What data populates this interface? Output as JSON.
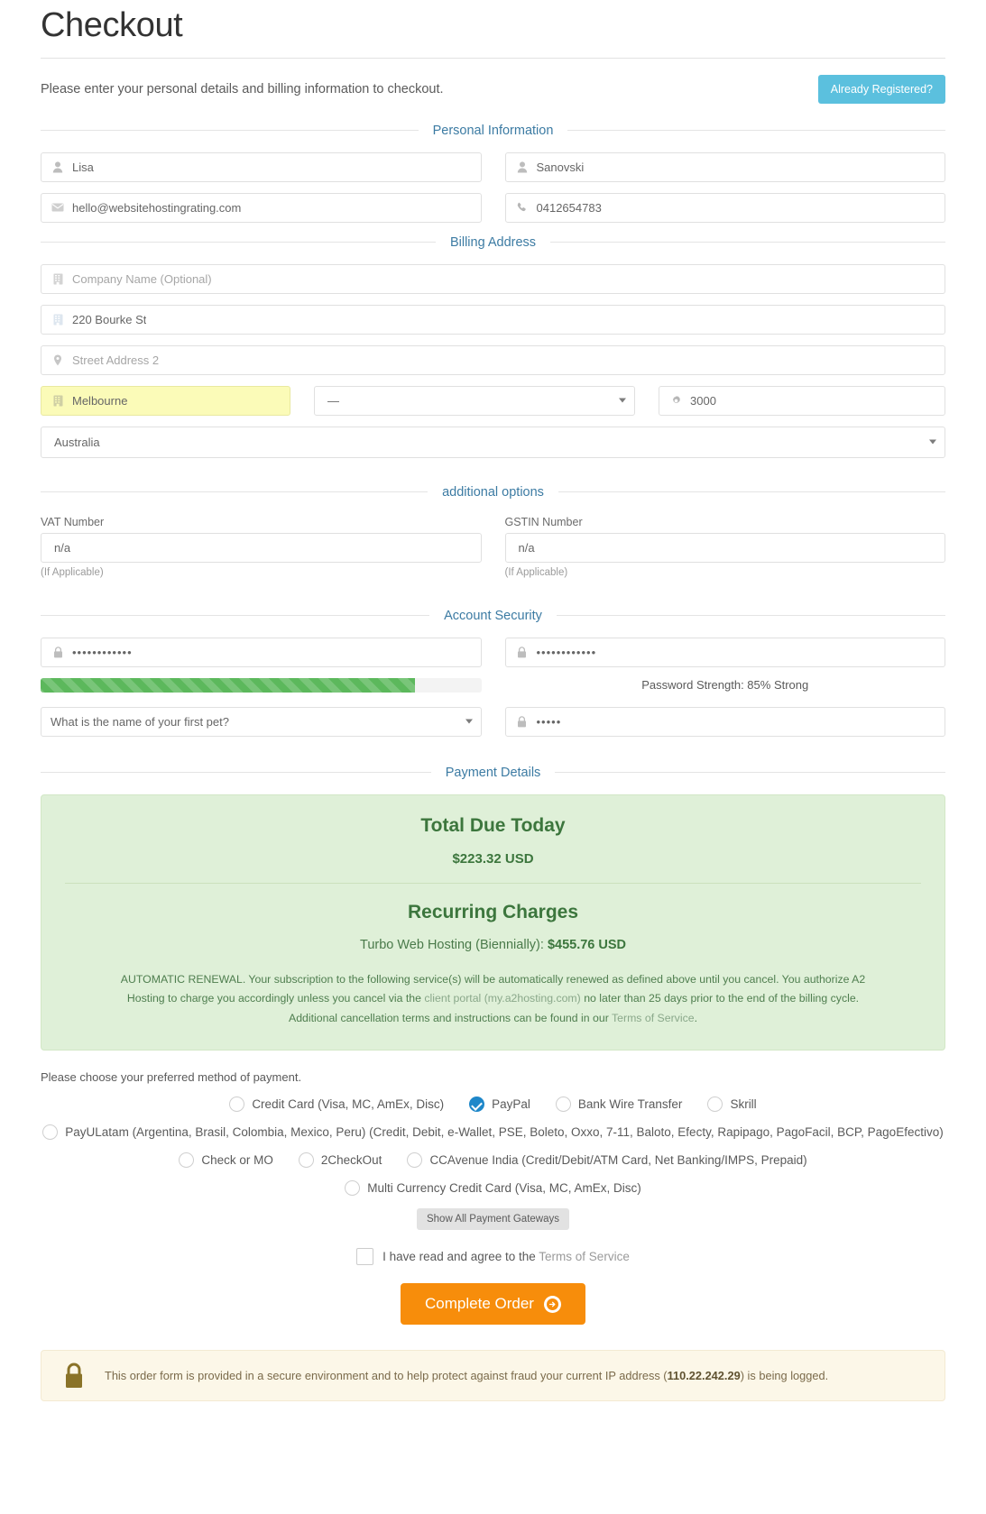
{
  "header": {
    "title": "Checkout",
    "intro": "Please enter your personal details and billing information to checkout.",
    "registered_button": "Already Registered?",
    "accent_color": "#5bc0de"
  },
  "sections": {
    "personal": "Personal Information",
    "billing": "Billing Address",
    "additional": "additional options",
    "security": "Account Security",
    "payment": "Payment Details"
  },
  "personal_information": {
    "first_name": {
      "value": "Lisa",
      "icon": "user-icon"
    },
    "last_name": {
      "value": "Sanovski",
      "icon": "user-icon"
    },
    "email": {
      "value": "hello@websitehostingrating.com",
      "icon": "envelope-icon"
    },
    "phone": {
      "value": "0412654783",
      "icon": "phone-icon"
    }
  },
  "billing_address": {
    "company": {
      "placeholder": "Company Name (Optional)",
      "value": "",
      "icon": "building-icon"
    },
    "street1": {
      "value": "220 Bourke St",
      "icon": "building-icon"
    },
    "street2": {
      "placeholder": "Street Address 2",
      "value": "",
      "icon": "map-pin-icon"
    },
    "city": {
      "value": "Melbourne",
      "icon": "building-icon",
      "highlighted": true
    },
    "state": {
      "value": "—"
    },
    "postcode": {
      "value": "3000",
      "icon": "gear-icon"
    },
    "country": {
      "value": "Australia"
    }
  },
  "additional_options": {
    "vat_label": "VAT Number",
    "vat_value": "n/a",
    "vat_hint": "(If Applicable)",
    "gstin_label": "GSTIN Number",
    "gstin_value": "n/a",
    "gstin_hint": "(If Applicable)"
  },
  "account_security": {
    "password": {
      "value": "••••••••••••",
      "icon": "lock-icon"
    },
    "password_confirm": {
      "value": "••••••••••••",
      "icon": "lock-icon"
    },
    "strength_text": "Password Strength: 85% Strong",
    "strength_percent": 85,
    "strength_color": "#5cb85c",
    "security_question": "What is the name of your first pet?",
    "security_answer": {
      "value": "•••••",
      "icon": "lock-icon"
    }
  },
  "payment_details": {
    "total_due_title": "Total Due Today",
    "total_due_amount": "$223.32 USD",
    "recurring_title": "Recurring Charges",
    "recurring_item": "Turbo Web Hosting (Biennially):",
    "recurring_amount": "$455.76 USD",
    "renewal_part1": "AUTOMATIC RENEWAL. Your subscription to the following service(s) will be automatically renewed as defined above until you cancel. You authorize A2 Hosting to charge you accordingly unless you cancel via the ",
    "renewal_link1": "client portal (my.a2hosting.com)",
    "renewal_part2": " no later than 25 days prior to the end of the billing cycle. Additional cancellation terms and instructions can be found in our ",
    "renewal_link2": "Terms of Service",
    "renewal_part3": ".",
    "panel_color": "#dff0d8",
    "panel_text_color": "#3c763d"
  },
  "payment_methods": {
    "intro": "Please choose your preferred method of payment.",
    "selected": "PayPal",
    "row1": [
      {
        "label": "Credit Card (Visa, MC, AmEx, Disc)",
        "selected": false
      },
      {
        "label": "PayPal",
        "selected": true
      },
      {
        "label": "Bank Wire Transfer",
        "selected": false
      },
      {
        "label": "Skrill",
        "selected": false
      }
    ],
    "row2": [
      {
        "label": "PayULatam (Argentina, Brasil, Colombia, Mexico, Peru) (Credit, Debit, e-Wallet, PSE, Boleto, Oxxo, 7-11, Baloto, Efecty, Rapipago, PagoFacil, BCP, PagoEfectivo)",
        "selected": false
      }
    ],
    "row3": [
      {
        "label": "Check or MO",
        "selected": false
      },
      {
        "label": "2CheckOut",
        "selected": false
      },
      {
        "label": "CCAvenue India (Credit/Debit/ATM Card, Net Banking/IMPS, Prepaid)",
        "selected": false
      }
    ],
    "row4": [
      {
        "label": "Multi Currency Credit Card (Visa, MC, AmEx, Disc)",
        "selected": false
      }
    ],
    "show_all_button": "Show All Payment Gateways"
  },
  "agreement": {
    "text_before": "I have read and agree to the ",
    "link": "Terms of Service",
    "checked": false
  },
  "submit": {
    "label": "Complete Order",
    "color": "#f78d0b"
  },
  "secure_notice": {
    "text_before": "This order form is provided in a secure environment and to help protect against fraud your current IP address (",
    "ip": "110.22.242.29",
    "text_after": ") is being logged.",
    "icon": "lock-icon",
    "background": "#fcf7e8"
  }
}
